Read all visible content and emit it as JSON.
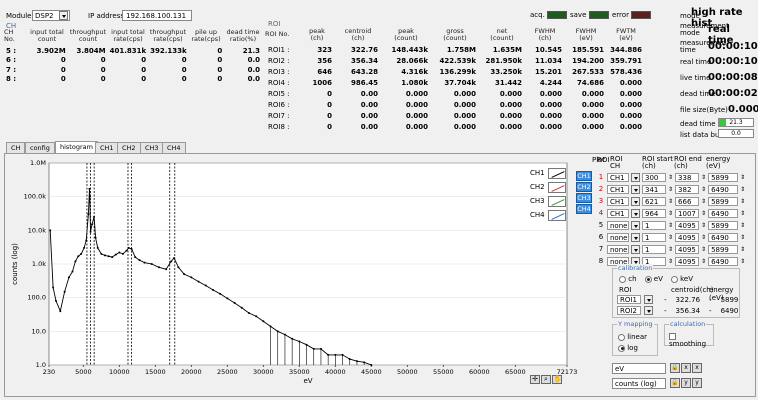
{
  "top": {
    "module_label": "Module",
    "module_value": "DSP2",
    "ip_label": "IP address",
    "ip_value": "192.168.100.131"
  },
  "ch_table": {
    "title": "CH",
    "headers": [
      "CH\nNo.",
      "input total\ncount",
      "throughput\ncount",
      "input total\nrate(cps)",
      "throughput\nrate(cps)",
      "pile up\nrate(cps)",
      "dead time\nratio(%)"
    ],
    "rows": [
      [
        "5 :",
        "3.902M",
        "3.804M",
        "401.831k",
        "392.133k",
        "0",
        "21.3"
      ],
      [
        "6 :",
        "0",
        "0",
        "0",
        "0",
        "0",
        "0.0"
      ],
      [
        "7 :",
        "0",
        "0",
        "0",
        "0",
        "0",
        "0.0"
      ],
      [
        "8 :",
        "0",
        "0",
        "0",
        "0",
        "0",
        "0.0"
      ]
    ]
  },
  "roi_table": {
    "title": "ROI",
    "headers": [
      "ROI No.",
      "peak\n(ch)",
      "centroid\n(ch)",
      "peak\n(count)",
      "gross\n(count)",
      "net\n(count)",
      "FWHM\n(ch)",
      "FWHM\n(eV)",
      "FWTM\n(eV)"
    ],
    "rows": [
      [
        "ROI1 :",
        "323",
        "322.76",
        "148.443k",
        "1.758M",
        "1.635M",
        "10.545",
        "185.591",
        "344.886"
      ],
      [
        "ROI2 :",
        "356",
        "356.34",
        "28.066k",
        "422.539k",
        "281.950k",
        "11.034",
        "194.200",
        "359.791"
      ],
      [
        "ROI3 :",
        "646",
        "643.28",
        "4.316k",
        "136.299k",
        "33.250k",
        "15.201",
        "267.533",
        "578.436"
      ],
      [
        "ROI4 :",
        "1006",
        "986.45",
        "1.080k",
        "37.704k",
        "31.442",
        "4.244",
        "74.686",
        "0.000"
      ],
      [
        "ROI5 :",
        "0",
        "0.00",
        "0.000",
        "0.000",
        "0.000",
        "0.000",
        "0.000",
        "0.000"
      ],
      [
        "ROI6 :",
        "0",
        "0.00",
        "0.000",
        "0.000",
        "0.000",
        "0.000",
        "0.000",
        "0.000"
      ],
      [
        "ROI7 :",
        "0",
        "0.00",
        "0.000",
        "0.000",
        "0.000",
        "0.000",
        "0.000",
        "0.000"
      ],
      [
        "ROI8 :",
        "0",
        "0.00",
        "0.000",
        "0.000",
        "0.000",
        "0.000",
        "0.000",
        "0.000"
      ]
    ]
  },
  "status": {
    "acq_label": "acq.",
    "save_label": "save",
    "error_label": "error",
    "acq_color": "#1f5a1f",
    "save_color": "#1f5a1f",
    "error_color": "#5a1f1f",
    "mode_label": "mode",
    "mode_value": "high rate hist",
    "meas_mode_label": "measurement\nmode",
    "meas_mode_value": "real time",
    "meas_time_label": "measuremen\ntime",
    "meas_time_value": "00:00:10",
    "real_time_label": "real time",
    "real_time_value": "00:00:10",
    "live_time_label": "live time",
    "live_time_value": "00:00:08",
    "dead_time_label": "dead time",
    "dead_time_value": "00:00:02",
    "file_size_label": "file size(Byte)",
    "file_size_value": "0.000",
    "dead_ratio_label": "dead time ratio",
    "dead_ratio_value": "21.3",
    "list_buffer_label": "list data buffer",
    "list_buffer_value": "0.0"
  },
  "tabs": [
    "CH",
    "config",
    "histogram",
    "CH1",
    "CH2",
    "CH3",
    "CH4"
  ],
  "chart_data": {
    "type": "scatter",
    "ylabel": "counts (log)",
    "xlabel": "eV",
    "x_ticks": [
      "230",
      "5000",
      "10000",
      "15000",
      "20000",
      "25000",
      "30000",
      "35000",
      "40000",
      "45000",
      "50000",
      "55000",
      "60000",
      "65000",
      "72173"
    ],
    "y_ticks": [
      "1.0M",
      "100.0k",
      "10.0k",
      "1.0k",
      "100.0",
      "10.0",
      "1.0"
    ],
    "xlim": [
      230,
      72173
    ],
    "ylim": [
      1,
      1000000
    ],
    "log_y": true,
    "legend": [
      "CH1",
      "CH2",
      "CH3",
      "CH4"
    ],
    "roi_markers_eV": [
      5500,
      6000,
      6500,
      11200,
      11700,
      17000,
      17700
    ],
    "series": [
      {
        "name": "CH1",
        "x": [
          400,
          800,
          1200,
          1800,
          2400,
          3000,
          3500,
          3900,
          4300,
          4700,
          5100,
          5400,
          5700,
          5850,
          5900,
          6000,
          6200,
          6490,
          6700,
          7000,
          7500,
          8000,
          8500,
          9000,
          9500,
          10000,
          10500,
          11000,
          11300,
          11700,
          12200,
          12800,
          13500,
          14500,
          15500,
          16500,
          17200,
          17600,
          18200,
          19000,
          20000,
          21000,
          22000,
          23000,
          24000,
          25000,
          26000,
          27000,
          28000,
          29000,
          30000,
          31000,
          32000,
          33000,
          34000,
          35000,
          36000,
          37000,
          38000,
          39000,
          40000,
          41000,
          42000,
          43000,
          44000,
          45000
        ],
        "y": [
          10000,
          200,
          80,
          40,
          150,
          400,
          600,
          1200,
          1700,
          2000,
          3000,
          5000,
          30000,
          170000,
          100000,
          9000,
          15000,
          25000,
          6000,
          3000,
          2000,
          1800,
          1700,
          1600,
          1900,
          2200,
          2000,
          2500,
          3000,
          2800,
          1600,
          1300,
          1100,
          1000,
          800,
          700,
          1200,
          1500,
          800,
          500,
          400,
          300,
          230,
          170,
          130,
          95,
          70,
          50,
          35,
          28,
          20,
          14,
          10,
          8,
          6,
          5,
          4,
          3,
          3,
          2,
          2,
          2,
          1.5,
          1.3,
          1.2,
          1
        ]
      }
    ]
  },
  "plot_panel": {
    "plot_label": "Plot",
    "roi_label": "ROI",
    "roi_ch_label": "ROI\nCH",
    "roi_start_label": "ROI start\n(ch)",
    "roi_end_label": "ROI end\n(ch)",
    "energy_label": "energy\n(eV)",
    "ch_buttons": [
      "CH1",
      "CH2",
      "CH3",
      "CH4"
    ],
    "rows": [
      {
        "n": "1",
        "ch": "CH1",
        "start": "300",
        "end": "338",
        "energy": "5899"
      },
      {
        "n": "2",
        "ch": "CH1",
        "start": "341",
        "end": "382",
        "energy": "6490"
      },
      {
        "n": "3",
        "ch": "CH1",
        "start": "621",
        "end": "666",
        "energy": "5899"
      },
      {
        "n": "4",
        "ch": "CH1",
        "start": "964",
        "end": "1007",
        "energy": "6490"
      },
      {
        "n": "5",
        "ch": "none",
        "start": "1",
        "end": "4095",
        "energy": "5899"
      },
      {
        "n": "6",
        "ch": "none",
        "start": "1",
        "end": "4095",
        "energy": "6490"
      },
      {
        "n": "7",
        "ch": "none",
        "start": "1",
        "end": "4095",
        "energy": "5899"
      },
      {
        "n": "8",
        "ch": "none",
        "start": "1",
        "end": "4095",
        "energy": "6490"
      }
    ],
    "calibration": {
      "title": "calibration",
      "opt_ch": "ch",
      "opt_ev": "eV",
      "opt_kev": "keV",
      "roi_label": "ROI",
      "centroid_label": "centroid(ch)",
      "energy_label": "energy (eV)",
      "r1": "ROI1",
      "r1_centroid": "322.76",
      "r1_energy": "5899",
      "r2": "ROI2",
      "r2_centroid": "356.34",
      "r2_energy": "6490"
    },
    "ymap": {
      "title": "Y mapping",
      "linear": "linear",
      "log": "log"
    },
    "calc": {
      "title": "calculation",
      "smoothing": "smoothing"
    },
    "axis_x_name": "eV",
    "axis_y_name": "counts (log)"
  }
}
